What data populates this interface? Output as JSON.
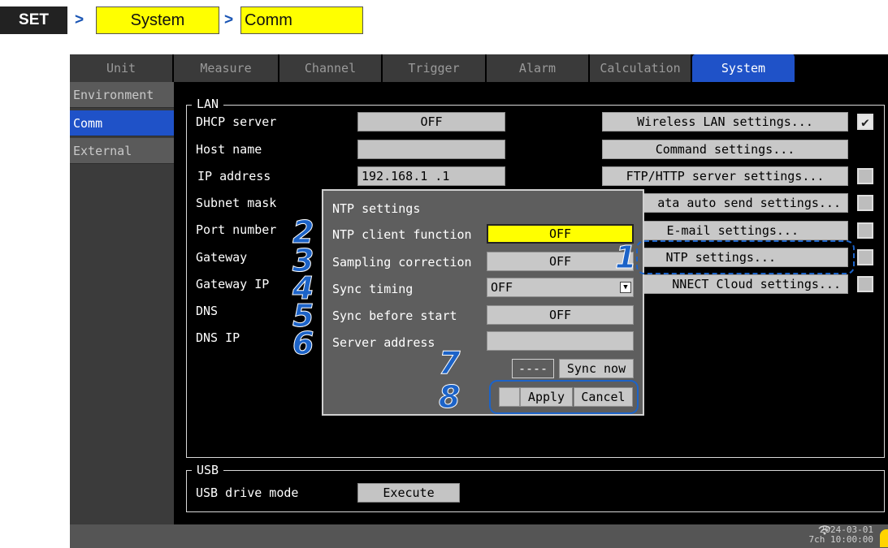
{
  "breadcrumb": {
    "set": "SET",
    "arrow": ">",
    "system": "System",
    "comm": "Comm"
  },
  "tabs": [
    "Unit",
    "Measure",
    "Channel",
    "Trigger",
    "Alarm",
    "Calculation",
    "System"
  ],
  "active_tab": "System",
  "left_nav": [
    "Environment",
    "Comm",
    "External"
  ],
  "active_left_nav": "Comm",
  "lan": {
    "title": "LAN",
    "rows": [
      {
        "label": "DHCP server",
        "value": "OFF"
      },
      {
        "label": "Host name",
        "value": ""
      },
      {
        "label": "IP address",
        "value": "192.168.1  .1"
      },
      {
        "label": "Subnet mask"
      },
      {
        "label": "Port number"
      },
      {
        "label": "Gateway"
      },
      {
        "label": "Gateway IP"
      },
      {
        "label": "DNS"
      },
      {
        "label": "DNS IP"
      }
    ],
    "settings_buttons": [
      {
        "label": "Wireless LAN settings...",
        "checked": true
      },
      {
        "label": "Command settings...",
        "checked": null
      },
      {
        "label": "FTP/HTTP server settings...",
        "checked": false
      },
      {
        "label": "ata auto send settings...",
        "checked": false
      },
      {
        "label": "E-mail settings...",
        "checked": false
      },
      {
        "label": "NTP settings...",
        "checked": false
      },
      {
        "label": "NNECT Cloud settings...",
        "checked": false
      }
    ]
  },
  "ntp_dialog": {
    "title": "NTP settings",
    "client_label": "NTP client function",
    "client_value": "OFF",
    "sampling_label": "Sampling correction",
    "sampling_value": "OFF",
    "sync_timing_label": "Sync timing",
    "sync_timing_value": "OFF",
    "sync_before_label": "Sync before start",
    "sync_before_value": "OFF",
    "server_label": "Server address",
    "server_value": "",
    "sync_status": "----",
    "sync_now": "Sync now",
    "apply": "Apply",
    "cancel": "Cancel"
  },
  "usb": {
    "title": "USB",
    "drive_mode_label": "USB drive mode",
    "execute": "Execute"
  },
  "status": {
    "date": "2024-03-01",
    "time": "10:00:00",
    "channels": "7ch"
  },
  "callouts": [
    "1",
    "2",
    "3",
    "4",
    "5",
    "6",
    "7",
    "8"
  ],
  "colors": {
    "accent_blue": "#1f52c8",
    "highlight_yellow": "#ffff00",
    "callout_blue": "#1c63c8"
  },
  "icons": {
    "checkbox_checked": "check-icon",
    "dropdown": "dropdown-arrow-icon",
    "wifi": "wifi-icon"
  }
}
